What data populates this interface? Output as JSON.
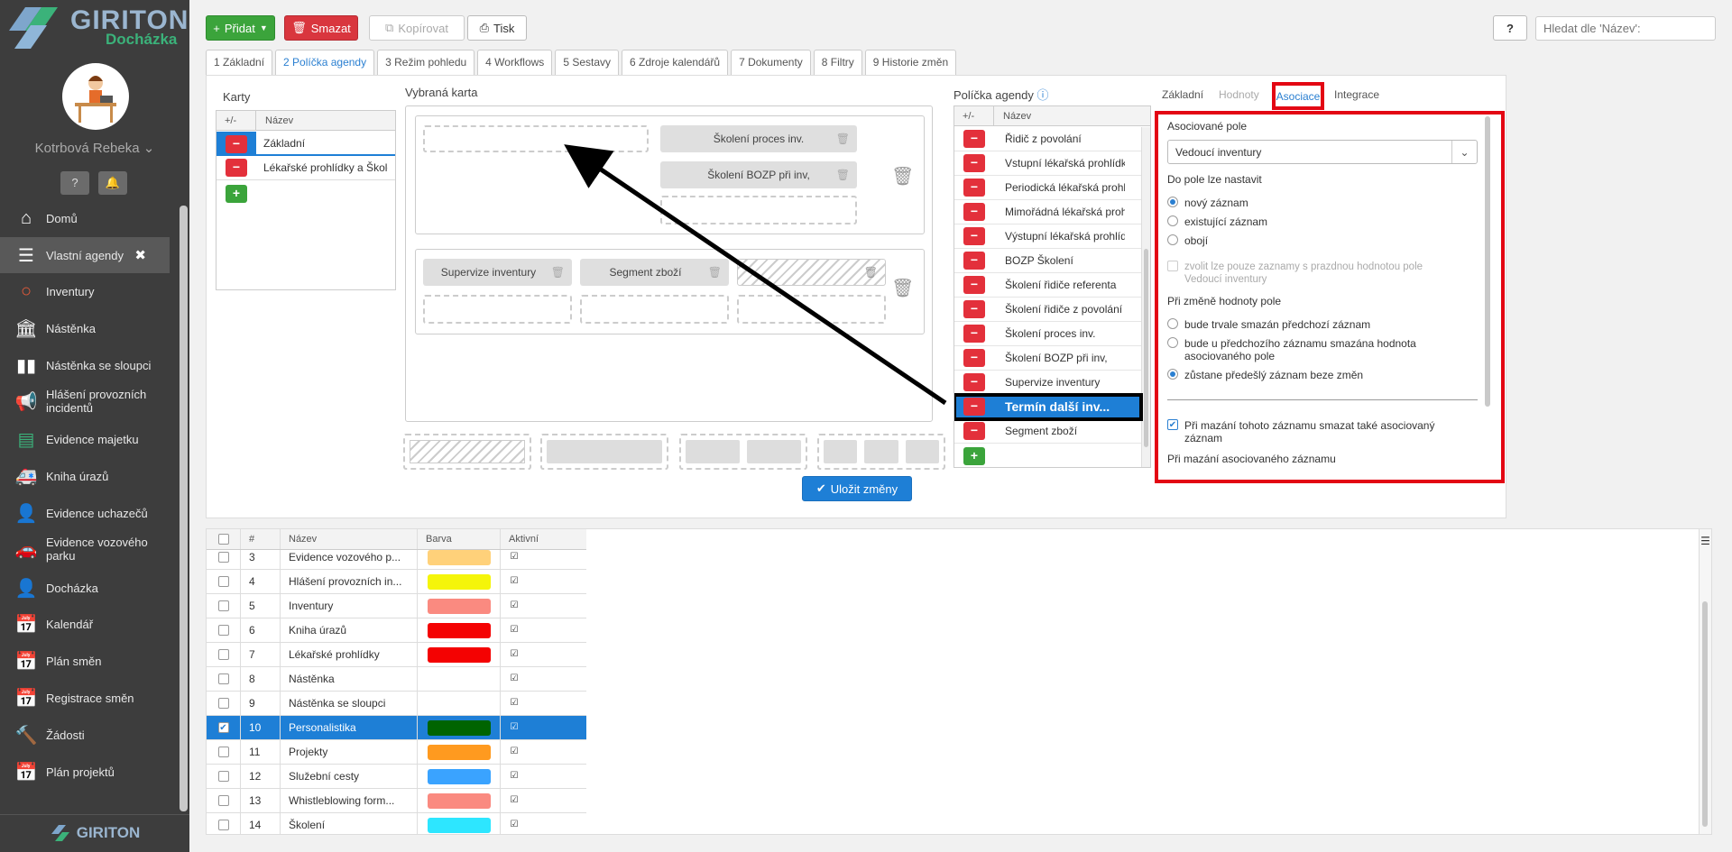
{
  "brand": {
    "name": "GIRITON",
    "product": "Docházka",
    "footer": "GIRITON"
  },
  "user": {
    "name": "Kotrbová Rebeka"
  },
  "menu": [
    {
      "label": "Domů",
      "icon": "home-icon"
    },
    {
      "label": "Vlastní agendy",
      "icon": "list-icon",
      "active": true
    },
    {
      "label": "Inventury",
      "icon": "circle-icon"
    },
    {
      "label": "Nástěnka",
      "icon": "building-icon"
    },
    {
      "label": "Nástěnka se sloupci",
      "icon": "columns-icon"
    },
    {
      "label": "Hlášení provozních incidentů",
      "icon": "megaphone-icon"
    },
    {
      "label": "Evidence majetku",
      "icon": "archive-icon"
    },
    {
      "label": "Kniha úrazů",
      "icon": "ambulance-icon"
    },
    {
      "label": "Evidence uchazečů",
      "icon": "user-add-icon"
    },
    {
      "label": "Evidence vozového parku",
      "icon": "car-icon"
    },
    {
      "label": "Docházka",
      "icon": "user-icon"
    },
    {
      "label": "Kalendář",
      "icon": "calendar-icon"
    },
    {
      "label": "Plán směn",
      "icon": "calendar-grid-icon"
    },
    {
      "label": "Registrace směn",
      "icon": "calendar-check-icon"
    },
    {
      "label": "Žádosti",
      "icon": "hammer-icon"
    },
    {
      "label": "Plán projektů",
      "icon": "calendar-plan-icon"
    }
  ],
  "toolbar": {
    "add": "Přidat",
    "delete": "Smazat",
    "copy": "Kopírovat",
    "print": "Tisk",
    "help": "?",
    "search_placeholder": "Hledat dle 'Název':"
  },
  "tabs": [
    "1 Základní",
    "2 Políčka agendy",
    "3 Režim pohledu",
    "4 Workflows",
    "5 Sestavy",
    "6 Zdroje kalendářů",
    "7 Dokumenty",
    "8 Filtry",
    "9 Historie změn"
  ],
  "cards": {
    "title": "Karty",
    "col_pm": "+/-",
    "col_name": "Název",
    "items": [
      "Základní",
      "Lékařské prohlídky a Školení"
    ]
  },
  "selected_card": {
    "title": "Vybraná karta",
    "chips": [
      "Školení proces inv.",
      "Školení BOZP při inv,",
      "Supervize inventury",
      "Segment zboží"
    ]
  },
  "fields": {
    "title": "Políčka agendy",
    "col_pm": "+/-",
    "col_name": "Název",
    "items": [
      "Řidič z povolání",
      "Vstupní lékařská prohlídka",
      "Periodická lékařská prohlídka",
      "Mimořádná lékařská prohlídka",
      "Výstupní lékařská prohlídka",
      "BOZP Školení",
      "Školení řidiče referenta",
      "Školení řidiče z povolání",
      "Školení proces inv.",
      "Školení BOZP při inv,",
      "Supervize inventury",
      "Termín další inventury",
      "Segment zboží"
    ],
    "selected": "Termín další inv..."
  },
  "save_button": "Uložit změny",
  "right_tabs": [
    "Základní",
    "Hodnoty",
    "Asociace",
    "Integrace"
  ],
  "assoc": {
    "field_label": "Asociované pole",
    "field_value": "Vedoucí inventury",
    "set_label": "Do pole lze nastavit",
    "set_opts": [
      "nový záznam",
      "existující záznam",
      "obojí"
    ],
    "empty_only": "zvolit lze pouze zaznamy s prazdnou hodnotou pole Vedoucí inventury",
    "change_label": "Při změně hodnoty pole",
    "change_opts": [
      "bude trvale smazán předchozí záznam",
      "bude u předchozího záznamu smazána hodnota asociovaného pole",
      "zůstane předešlý záznam beze změn"
    ],
    "delete_also": "Při mazání tohoto záznamu smazat také asociovaný záznam",
    "on_assoc_delete": "Při mazání asociovaného záznamu"
  },
  "grid": {
    "headers": [
      "#",
      "Název",
      "Barva",
      "Aktivní"
    ],
    "rows": [
      {
        "n": "3",
        "name": "Evidence vozového p...",
        "color": "#ffd17a"
      },
      {
        "n": "4",
        "name": "Hlášení provozních in...",
        "color": "#f5f50a"
      },
      {
        "n": "5",
        "name": "Inventury",
        "color": "#fa8a80"
      },
      {
        "n": "6",
        "name": "Kniha úrazů",
        "color": "#f40202"
      },
      {
        "n": "7",
        "name": "Lékařské prohlídky",
        "color": "#f40202"
      },
      {
        "n": "8",
        "name": "Nástěnka",
        "color": "#ffffff"
      },
      {
        "n": "9",
        "name": "Nástěnka se sloupci",
        "color": ""
      },
      {
        "n": "10",
        "name": "Personalistika",
        "color": "#006400",
        "selected": true
      },
      {
        "n": "11",
        "name": "Projekty",
        "color": "#ff9a1f"
      },
      {
        "n": "12",
        "name": "Služební cesty",
        "color": "#3aa3ff"
      },
      {
        "n": "13",
        "name": "Whistleblowing form...",
        "color": "#fa8a80"
      },
      {
        "n": "14",
        "name": "Školení",
        "color": "#2de6ff"
      }
    ]
  },
  "colors": {
    "accent": "#2a7fd1",
    "green": "#3ba43b",
    "red": "#e3303b",
    "highlight": "#e30613"
  }
}
